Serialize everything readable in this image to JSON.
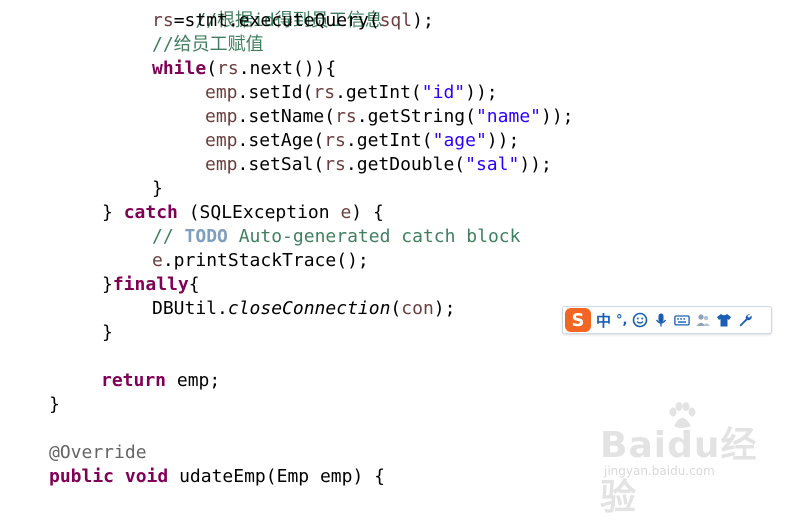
{
  "code": {
    "line0": {
      "cmt": "//根据id得到员工信息"
    },
    "line1": {
      "var": "rs",
      "rest1": "=stmt.executeQuery(",
      "var2": "sql",
      "rest2": ");"
    },
    "line2": {
      "cmt": "//给员工赋值"
    },
    "line3": {
      "kw": "while",
      "rest1": "(",
      "var": "rs",
      "rest2": ".next()){"
    },
    "line4": {
      "var": "emp",
      "m": ".setId(",
      "var2": "rs",
      "m2": ".getInt(",
      "str": "\"id\"",
      "end": "));"
    },
    "line5": {
      "var": "emp",
      "m": ".setName(",
      "var2": "rs",
      "m2": ".getString(",
      "str": "\"name\"",
      "end": "));"
    },
    "line6": {
      "var": "emp",
      "m": ".setAge(",
      "var2": "rs",
      "m2": ".getInt(",
      "str": "\"age\"",
      "end": "));"
    },
    "line7": {
      "var": "emp",
      "m": ".setSal(",
      "var2": "rs",
      "m2": ".getDouble(",
      "str": "\"sal\"",
      "end": "));"
    },
    "line8": {
      "text": "}"
    },
    "line9": {
      "pre": "} ",
      "kw": "catch",
      "mid": " (SQLException ",
      "var": "e",
      "end": ") {"
    },
    "line10": {
      "cmt1": "// ",
      "todo": "TODO",
      "cmt2": " Auto-generated catch block"
    },
    "line11": {
      "var": "e",
      "rest": ".printStackTrace();"
    },
    "line12": {
      "pre": "}",
      "kw": "finally",
      "end": "{"
    },
    "line13": {
      "pre": "DBUtil.",
      "ital": "closeConnection",
      "mid": "(",
      "var": "con",
      "end": ");"
    },
    "line14": {
      "text": "}"
    },
    "line15": {
      "kw": "return",
      "rest": " emp;"
    },
    "line16": {
      "text": "}"
    },
    "line17": {
      "ann": "@Override"
    },
    "line18": {
      "kw1": "public",
      "sp": " ",
      "kw2": "void",
      "rest": " udateEmp(Emp emp) {"
    }
  },
  "ime": {
    "logo": "S",
    "mode": "中",
    "punct": "°,",
    "icons": [
      "smiley-icon",
      "microphone-icon",
      "keyboard-icon",
      "users-icon",
      "shirt-icon",
      "wrench-icon"
    ]
  },
  "watermark": {
    "brand": "Baidu经验",
    "url": "jingyan.baidu.com"
  },
  "colors": {
    "keyword": "#7f0055",
    "string": "#2a00ff",
    "comment": "#3f7f5f",
    "local_var": "#6a3e3e",
    "todo": "#7f9fbf",
    "ime_logo": "#f26522",
    "ime_text": "#1a5fb4"
  }
}
